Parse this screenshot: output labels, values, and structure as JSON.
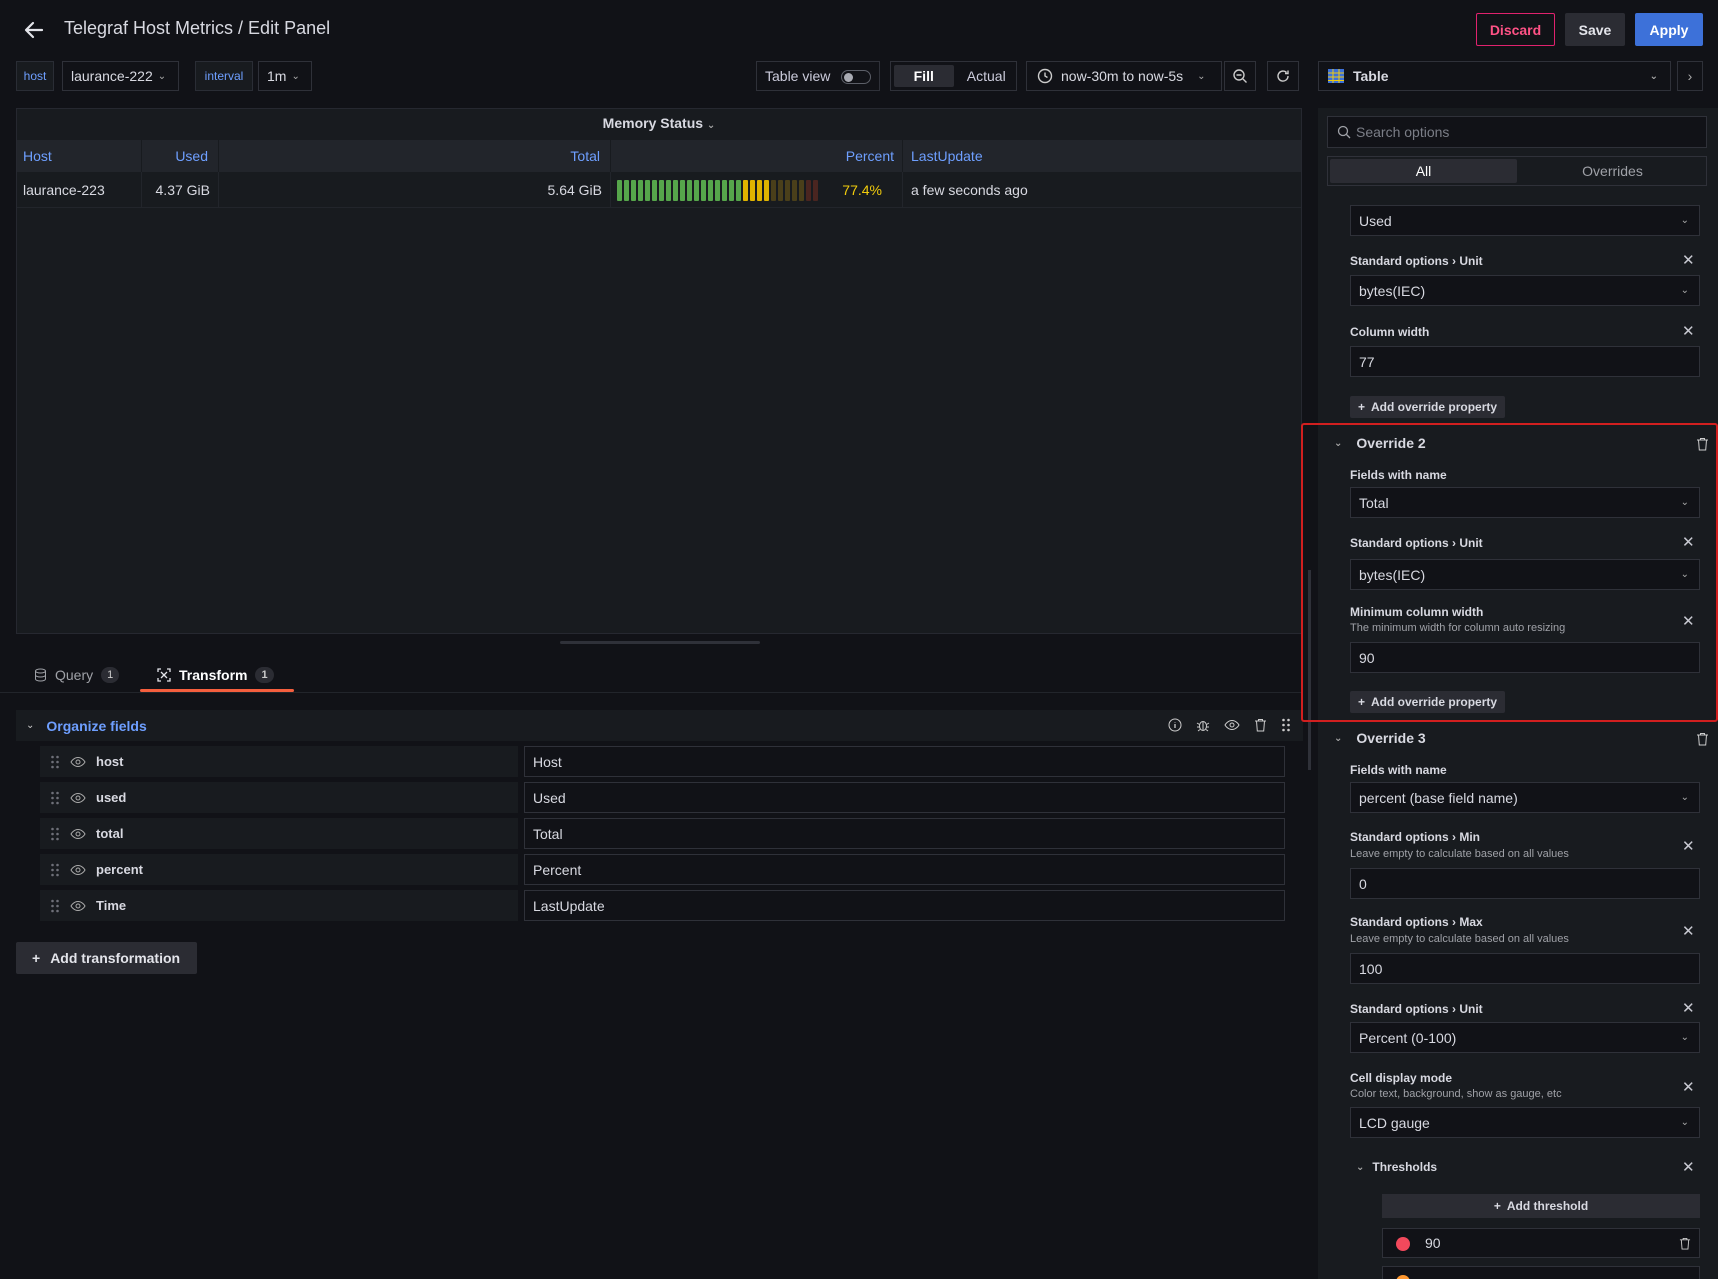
{
  "header": {
    "title": "Telegraf Host Metrics / Edit Panel",
    "discard": "Discard",
    "save": "Save",
    "apply": "Apply"
  },
  "variables": [
    {
      "label": "host",
      "value": "laurance-222"
    },
    {
      "label": "interval",
      "value": "1m"
    }
  ],
  "toolbar": {
    "table_view": "Table view",
    "fill": "Fill",
    "actual": "Actual",
    "time_range": "now-30m to now-5s"
  },
  "viz": {
    "name": "Table"
  },
  "panel": {
    "title": "Memory Status",
    "columns": [
      "Host",
      "Used",
      "Total",
      "Percent",
      "LastUpdate"
    ],
    "row": {
      "host": "laurance-223",
      "used": "4.37 GiB",
      "total": "5.64 GiB",
      "percent": "77.4%",
      "last_update": "a few seconds ago",
      "gauge_fraction": 0.774
    }
  },
  "tabs": [
    {
      "label": "Query",
      "count": "1"
    },
    {
      "label": "Transform",
      "count": "1"
    }
  ],
  "transform": {
    "title": "Organize fields",
    "fields": [
      {
        "name": "host",
        "rename": "Host"
      },
      {
        "name": "used",
        "rename": "Used"
      },
      {
        "name": "total",
        "rename": "Total"
      },
      {
        "name": "percent",
        "rename": "Percent"
      },
      {
        "name": "Time",
        "rename": "LastUpdate"
      }
    ],
    "add_button": "Add transformation"
  },
  "options": {
    "search_placeholder": "Search options",
    "tab_all": "All",
    "tab_overrides": "Overrides",
    "override1": {
      "field_value": "Used",
      "unit_label_a": "Standard options",
      "unit_label_b": "Unit",
      "unit_value": "bytes(IEC)",
      "colwidth_label": "Column width",
      "colwidth_value": "77",
      "add_prop": "Add override property"
    },
    "override2": {
      "title": "Override 2",
      "fields_label": "Fields with name",
      "field_value": "Total",
      "unit_label_a": "Standard options",
      "unit_label_b": "Unit",
      "unit_value": "bytes(IEC)",
      "mincol_label": "Minimum column width",
      "mincol_desc": "The minimum width for column auto resizing",
      "mincol_value": "90",
      "add_prop": "Add override property"
    },
    "override3": {
      "title": "Override 3",
      "fields_label": "Fields with name",
      "field_value": "percent (base field name)",
      "min_label_a": "Standard options",
      "min_label_b": "Min",
      "min_desc": "Leave empty to calculate based on all values",
      "min_value": "0",
      "max_label_a": "Standard options",
      "max_label_b": "Max",
      "max_desc": "Leave empty to calculate based on all values",
      "max_value": "100",
      "unit_label_a": "Standard options",
      "unit_label_b": "Unit",
      "unit_value": "Percent (0-100)",
      "cell_label": "Cell display mode",
      "cell_desc": "Color text, background, show as gauge, etc",
      "cell_value": "LCD gauge",
      "thresholds_label": "Thresholds",
      "add_threshold": "Add threshold",
      "threshold_value": "90"
    }
  },
  "colors": {
    "accent": "#3d71d9",
    "link": "#6e9fff",
    "danger": "#e0226e",
    "percent_text": "#f2cc0c",
    "threshold_red": "#f2495c"
  }
}
